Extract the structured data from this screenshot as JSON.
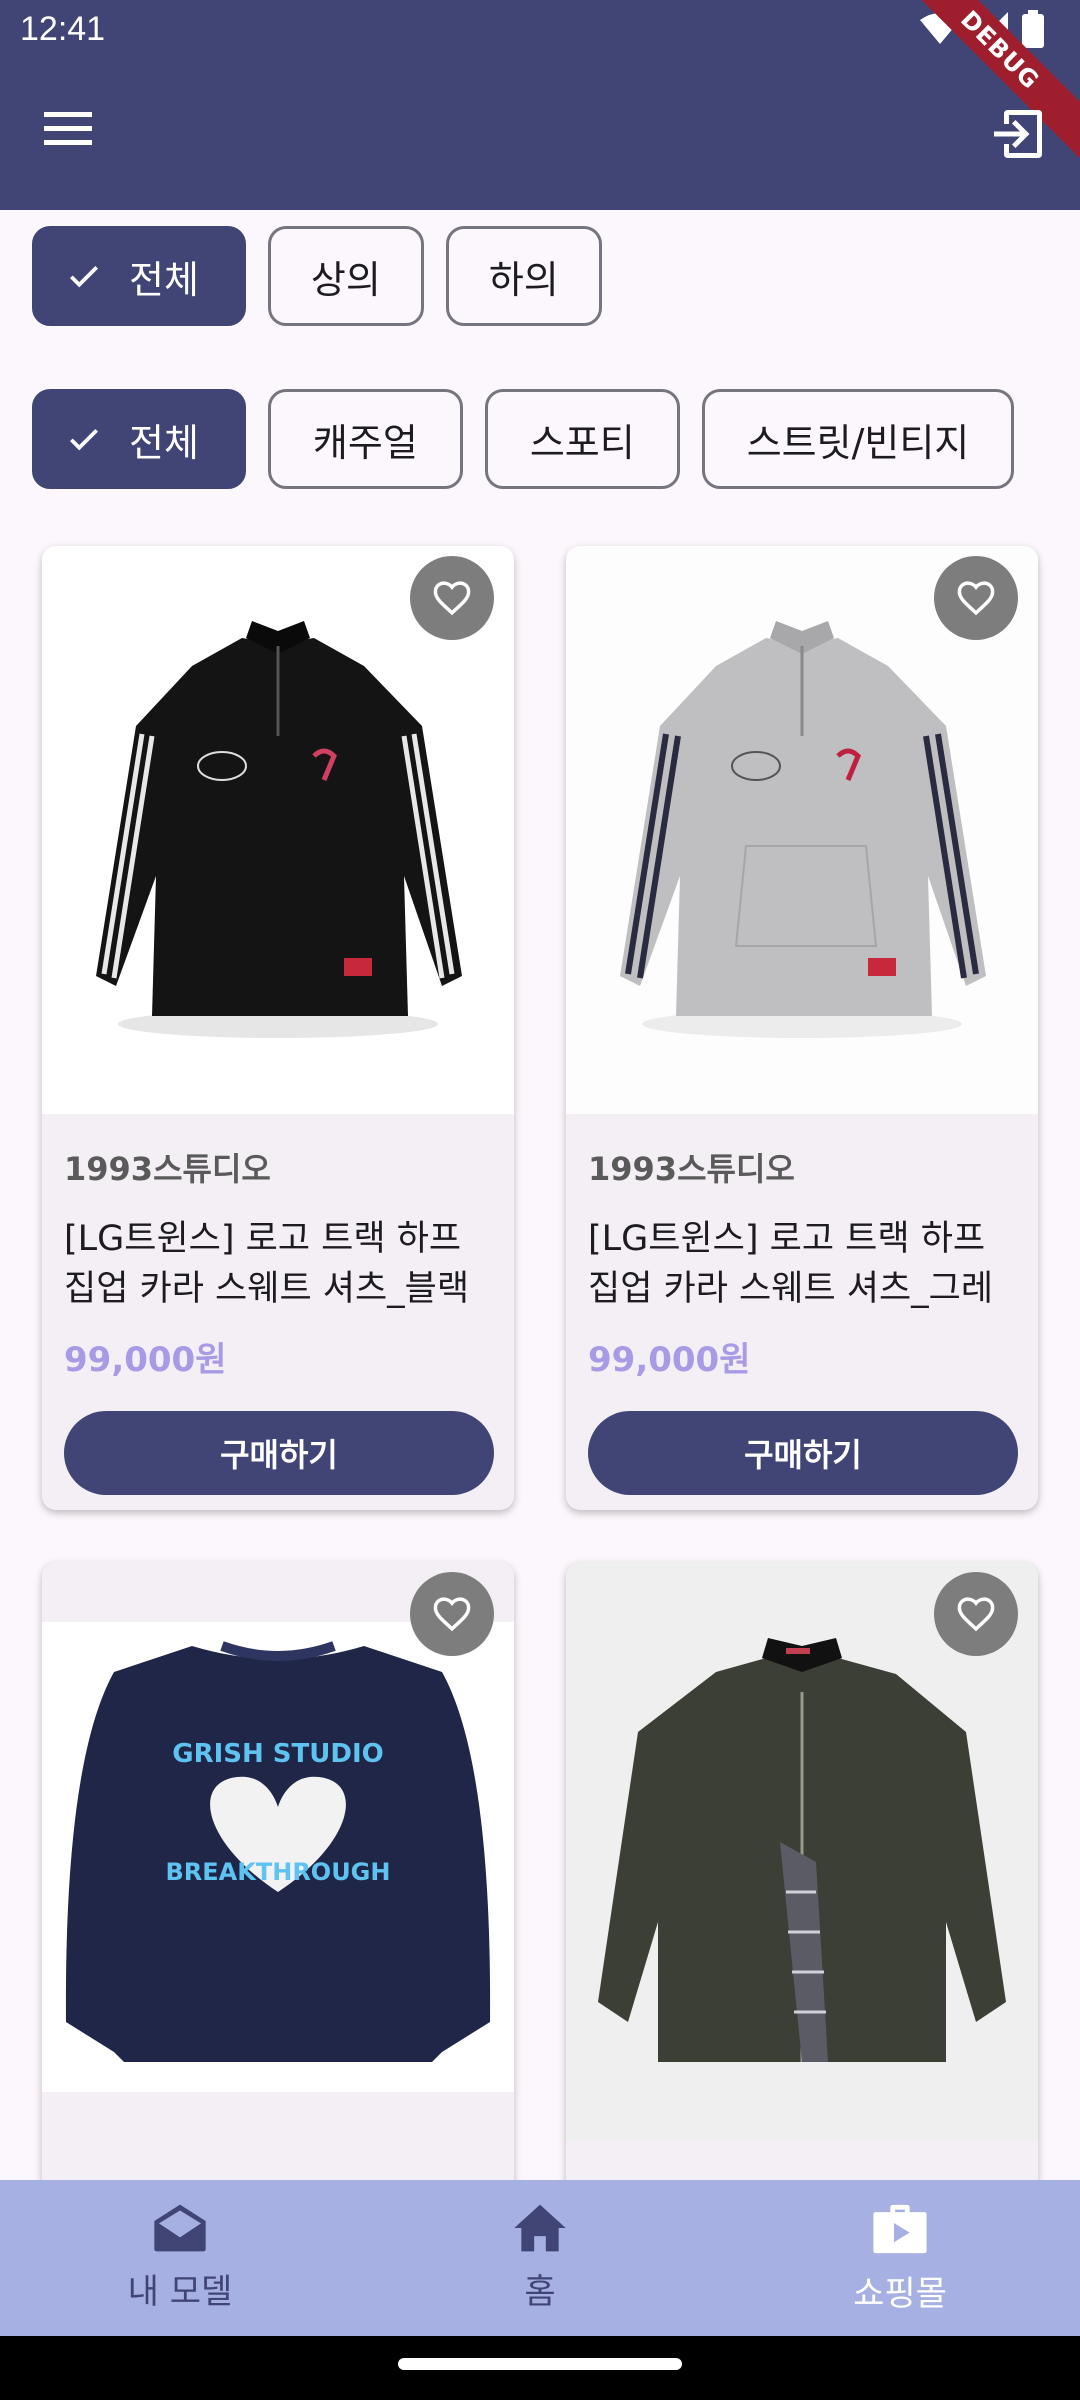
{
  "status_bar": {
    "time": "12:41"
  },
  "app_bar": {
    "debug_label": "DEBUG"
  },
  "filters": {
    "category": [
      {
        "label": "전체",
        "selected": true
      },
      {
        "label": "상의",
        "selected": false
      },
      {
        "label": "하의",
        "selected": false
      }
    ],
    "style": [
      {
        "label": "전체",
        "selected": true
      },
      {
        "label": "캐주얼",
        "selected": false
      },
      {
        "label": "스포티",
        "selected": false
      },
      {
        "label": "스트릿/빈티지",
        "selected": false
      }
    ]
  },
  "products": [
    {
      "brand": "1993스튜디오",
      "title": "[LG트윈스] 로고 트랙 하프 집업 카라 스웨트 셔츠_블랙",
      "price": "99,000원",
      "buy_label": "구매하기",
      "image": "black half-zip track sweatshirt"
    },
    {
      "brand": "1993스튜디오",
      "title": "[LG트윈스] 로고 트랙 하프 집업 카라 스웨트 셔츠_그레이",
      "price": "99,000원",
      "buy_label": "구매하기",
      "image": "grey half-zip track sweatshirt"
    },
    {
      "brand": "",
      "title": "",
      "price": "",
      "buy_label": "",
      "image": "navy sweatshirt with heart print"
    },
    {
      "brand": "",
      "title": "",
      "price": "",
      "buy_label": "",
      "image": "dark green corduroy-collar jacket"
    }
  ],
  "bottom_nav": [
    {
      "label": "내 모델",
      "icon": "drafts-icon"
    },
    {
      "label": "홈",
      "icon": "home-icon"
    },
    {
      "label": "쇼핑몰",
      "icon": "shop-icon"
    }
  ],
  "colors": {
    "primary": "#404575",
    "background": "#FCF7FC",
    "price": "#A89AE4",
    "nav_bar": "#A7B0E2"
  }
}
